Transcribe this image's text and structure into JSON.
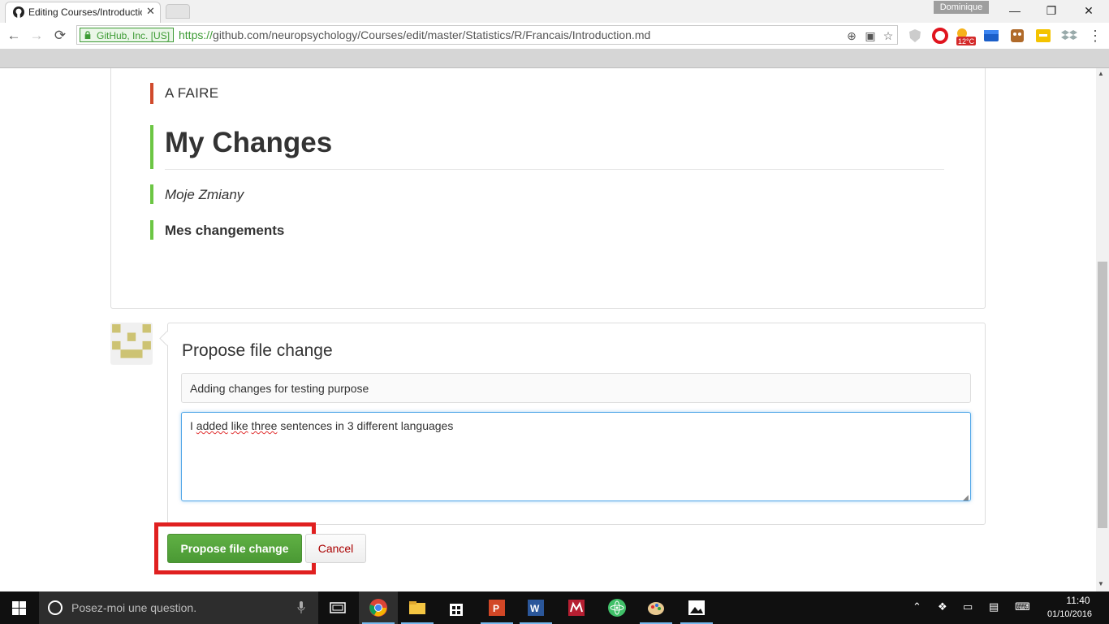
{
  "browser": {
    "tab_title": "Editing Courses/Introductio",
    "profile_name": "Dominique",
    "ev_label": "GitHub, Inc. [US]",
    "url_protocol": "https://",
    "url_rest": "github.com/neuropsychology/Courses/edit/master/Statistics/R/Francais/Introduction.md",
    "weather_badge": "12°C"
  },
  "preview": {
    "todo_label": "A FAIRE",
    "heading": "My Changes",
    "italic_line": "Moje Zmiany",
    "bold_line": "Mes changements"
  },
  "commit": {
    "heading": "Propose file change",
    "summary_value": "Adding changes for testing purpose",
    "description_words": [
      "I",
      "added",
      "like",
      "three",
      "sentences in 3 different languages"
    ],
    "propose_label": "Propose file change",
    "cancel_label": "Cancel"
  },
  "taskbar": {
    "search_placeholder": "Posez-moi une question.",
    "time": "11:40",
    "date": "01/10/2016"
  },
  "colors": {
    "github_green": "#6cc644",
    "todo_bar": "#d04a2c",
    "highlight_red": "#e02020"
  }
}
